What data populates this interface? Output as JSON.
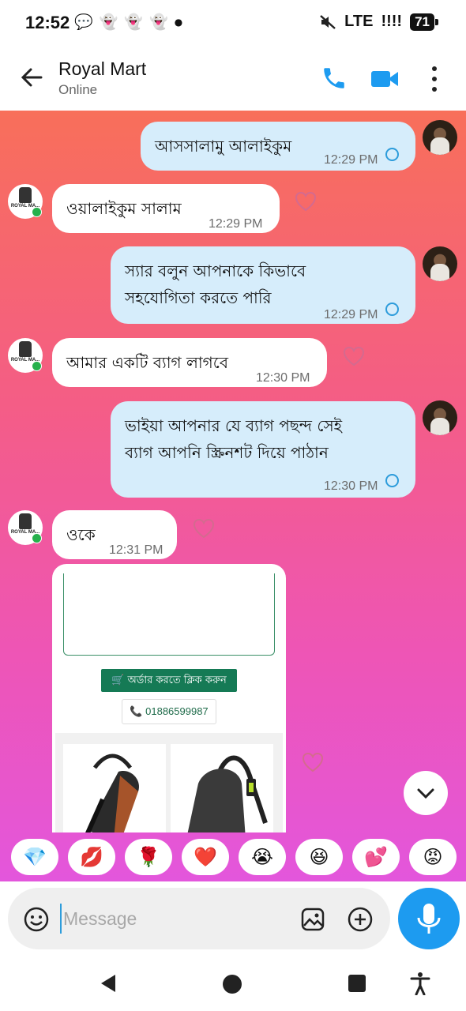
{
  "status_bar": {
    "time": "12:52",
    "notification_icons": [
      "chat-icon",
      "snapchat-icon",
      "snapchat-icon",
      "snapchat-icon",
      "dot-icon"
    ],
    "network": "LTE",
    "signal": "!!!!",
    "battery": "71"
  },
  "header": {
    "contact_name": "Royal Mart",
    "contact_status": "Online"
  },
  "colors": {
    "accent": "#1d9bf0",
    "outgoing_bubble": "#d6edfb",
    "incoming_bubble": "#ffffff",
    "chat_gradient_top": "#f86f5a",
    "chat_gradient_bottom": "#e356dc",
    "order_button": "#157a55"
  },
  "messages": [
    {
      "direction": "outgoing",
      "text": "আসসালামু আলাইকুম",
      "time": "12:29 PM"
    },
    {
      "direction": "incoming",
      "text": "ওয়ালাইকুম সালাম",
      "time": "12:29 PM"
    },
    {
      "direction": "outgoing",
      "line1": "স্যার বলুন আপনাকে কিভাবে",
      "line2": "সহযোগিতা করতে পারি",
      "time": "12:29 PM"
    },
    {
      "direction": "incoming",
      "text": "আমার একটি ব্যাগ লাগবে",
      "time": "12:30 PM"
    },
    {
      "direction": "outgoing",
      "line1": "ভাইয়া আপনার যে ব্যাগ পছন্দ সেই",
      "line2": "ব্যাগ  আপনি স্ক্রিনশট দিয়ে পাঠান",
      "time": "12:30 PM"
    },
    {
      "direction": "incoming",
      "text": "ওকে",
      "time": "12:31 PM"
    }
  ],
  "shop_avatar_text": "ROYAL MA...",
  "product_card": {
    "order_button": "🛒 অর্ডার করতে ক্লিক করুন",
    "phone": "📞 01886599987"
  },
  "reactions": [
    "💎",
    "💋",
    "🌹",
    "❤️",
    "😭",
    "😆",
    "💕",
    "😡",
    "👍"
  ],
  "composer": {
    "placeholder": "Message"
  }
}
